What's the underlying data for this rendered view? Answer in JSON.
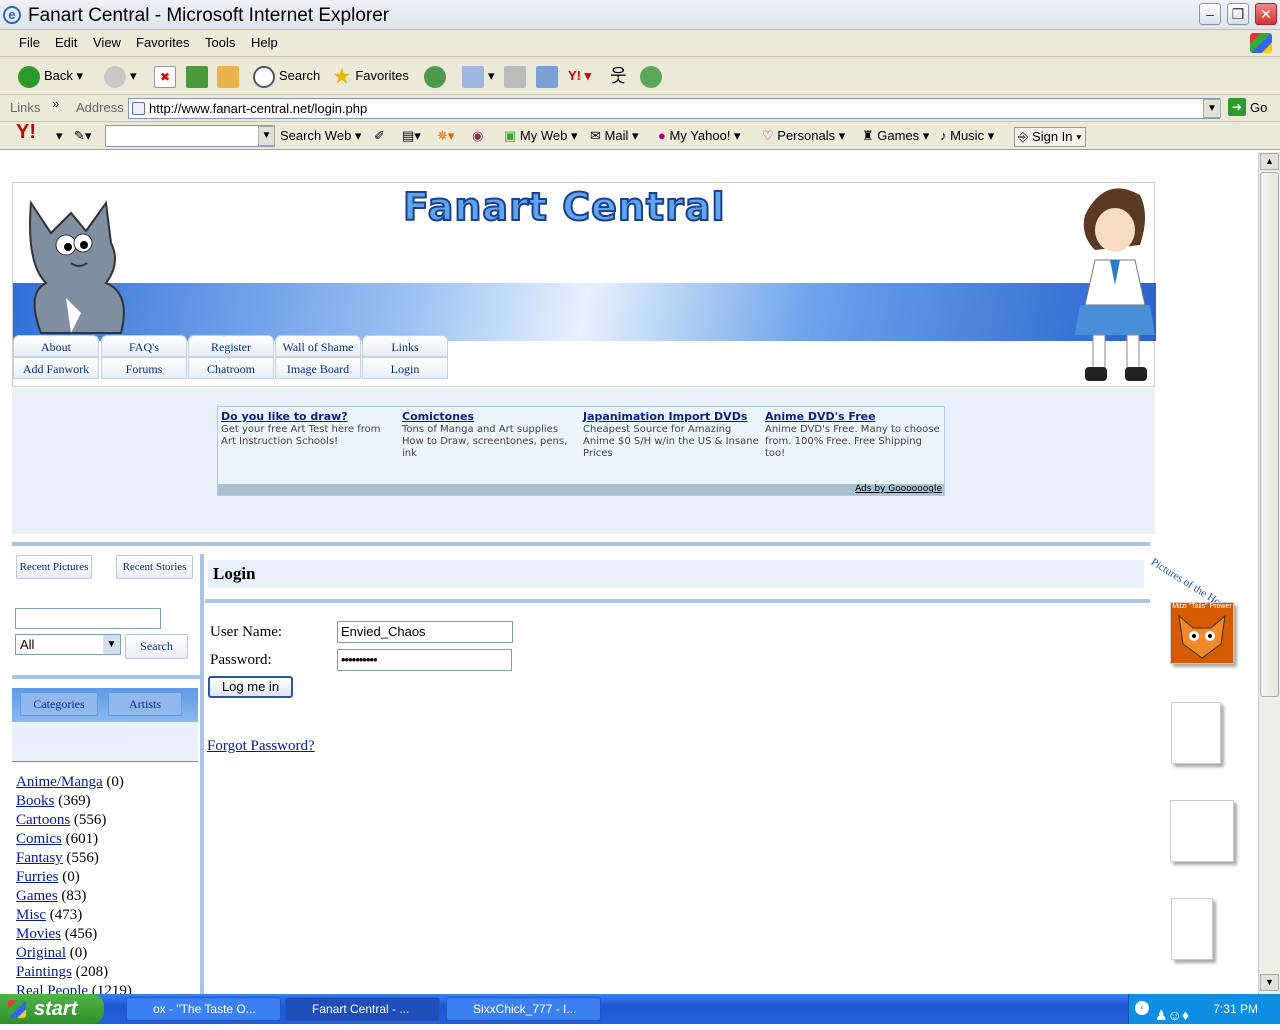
{
  "window": {
    "title": "Fanart Central - Microsoft Internet Explorer"
  },
  "menu": [
    "File",
    "Edit",
    "View",
    "Favorites",
    "Tools",
    "Help"
  ],
  "toolbar": {
    "back": "Back",
    "search": "Search",
    "favorites": "Favorites"
  },
  "address": {
    "label": "Address",
    "links": "Links",
    "url": "http://www.fanart-central.net/login.php",
    "go": "Go"
  },
  "yahoo": {
    "search_web": "Search Web",
    "my_web": "My Web",
    "mail": "Mail",
    "my_yahoo": "My Yahoo!",
    "personals": "Personals",
    "games": "Games",
    "music": "Music",
    "sign_in": "Sign In"
  },
  "site": {
    "logo": "Fanart Central",
    "nav_top": [
      "About",
      "FAQ's",
      "Register",
      "Wall of Shame",
      "Links"
    ],
    "nav_bottom": [
      "Add Fanwork",
      "Forums",
      "Chatroom",
      "Image Board",
      "Login"
    ]
  },
  "ads": {
    "items": [
      {
        "title": "Do you like to draw?",
        "text": "Get your free Art Test here from Art Instruction Schools!"
      },
      {
        "title": "Comictones",
        "text": "Tons of Manga and Art supplies How to Draw, screentones, pens, ink"
      },
      {
        "title": "Japanimation Import DVDs",
        "text": "Cheapest Source for Amazing Anime $0 S/H w/in the US & Insane Prices"
      },
      {
        "title": "Anime DVD's Free",
        "text": "Anime DVD's Free. Many to choose from. 100% Free. Free Shipping too!"
      }
    ],
    "footer": "Ads by Goooooogle"
  },
  "sidebar": {
    "recent_pictures": "Recent Pictures",
    "recent_stories": "Recent Stories",
    "search_select": "All",
    "search_button": "Search",
    "tab_categories": "Categories",
    "tab_artists": "Artists",
    "categories": [
      {
        "name": "Anime/Manga",
        "count": "(0)"
      },
      {
        "name": "Books",
        "count": "(369)"
      },
      {
        "name": "Cartoons",
        "count": "(556)"
      },
      {
        "name": "Comics",
        "count": "(601)"
      },
      {
        "name": "Fantasy",
        "count": "(556)"
      },
      {
        "name": "Furries",
        "count": "(0)"
      },
      {
        "name": "Games",
        "count": "(83)"
      },
      {
        "name": "Misc",
        "count": "(473)"
      },
      {
        "name": "Movies",
        "count": "(456)"
      },
      {
        "name": "Original",
        "count": "(0)"
      },
      {
        "name": "Paintings",
        "count": "(208)"
      },
      {
        "name": "Real People",
        "count": "(1219)"
      }
    ]
  },
  "login": {
    "heading": "Login",
    "username_label": "User Name:",
    "username_value": "Envied_Chaos",
    "password_label": "Password:",
    "password_value": "••••••••••",
    "submit": "Log me in",
    "forgot": "Forgot Password?"
  },
  "right": {
    "pictures_of_hour": "Pictures of the Hou",
    "thumb1_text": "Mitzi \"Tails\" Prower"
  },
  "taskbar": {
    "start": "start",
    "tasks": [
      "ox - \"The Taste O...",
      "Fanart Central - ...",
      "SixxChick_777 - I..."
    ],
    "time": "7:31 PM"
  }
}
